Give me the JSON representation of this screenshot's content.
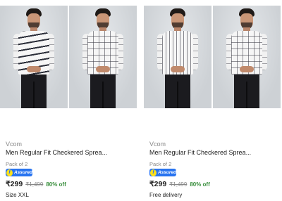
{
  "products": [
    {
      "brand": "Vcom",
      "title": "Men Regular Fit Checkered Sprea...",
      "pack": "Pack of 2",
      "assured": "Assured",
      "assured_icon": "f",
      "price": "₹299",
      "mrp": "₹1,499",
      "discount": "80% off",
      "extra": "Size XXL"
    },
    {
      "brand": "Vcom",
      "title": "Men Regular Fit Checkered Sprea...",
      "pack": "Pack of 2",
      "assured": "Assured",
      "assured_icon": "f",
      "price": "₹299",
      "mrp": "₹1,499",
      "discount": "80% off",
      "extra": "Free delivery"
    }
  ],
  "colors": {
    "assured_blue": "#2874f0",
    "discount_green": "#388e3c",
    "muted_text": "#878787"
  }
}
